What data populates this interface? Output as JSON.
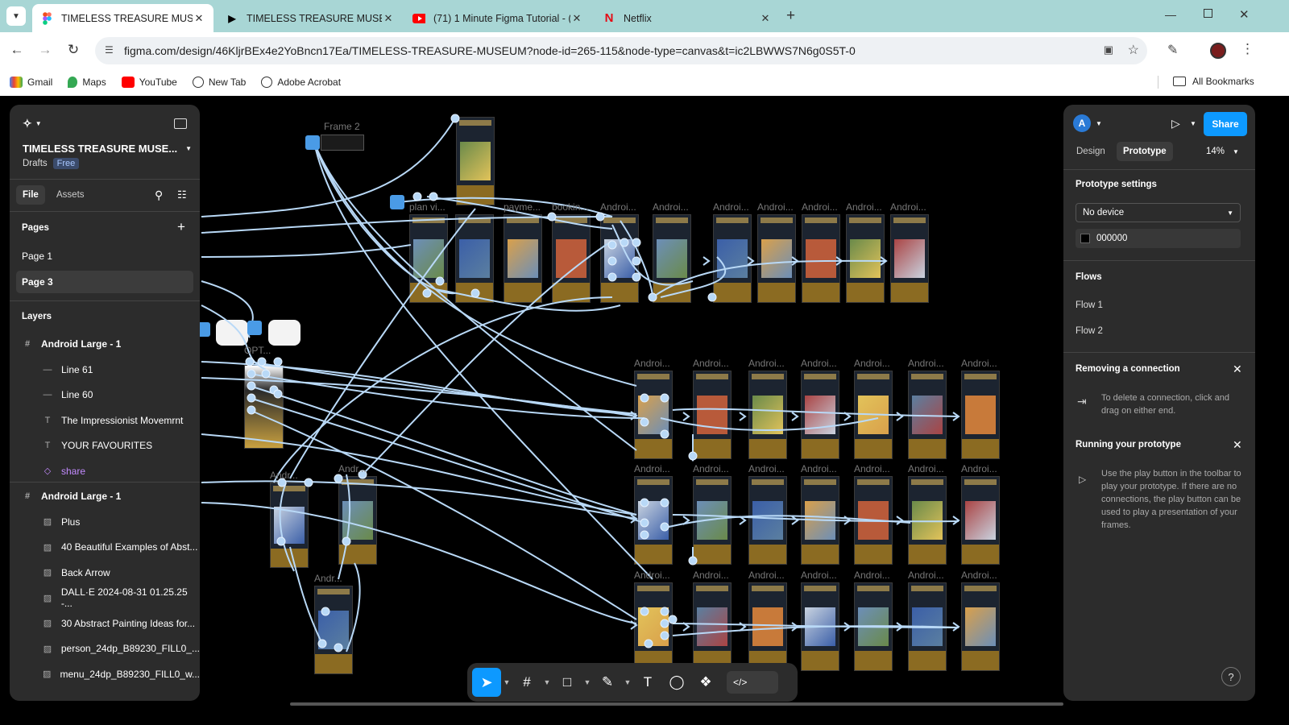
{
  "browser": {
    "tabs": [
      {
        "title": "TIMELESS TREASURE MUSEUM",
        "icon": "figma-icon",
        "active": true
      },
      {
        "title": "TIMELESS TREASURE MUSEUM",
        "icon": "play-icon"
      },
      {
        "title": "(71) 1 Minute Figma Tutorial - (",
        "icon": "youtube-icon"
      },
      {
        "title": "Netflix",
        "icon": "netflix-icon"
      }
    ],
    "url": "figma.com/design/46KljrBEx4e2YoBncn17Ea/TIMELESS-TREASURE-MUSEUM?node-id=265-115&node-type=canvas&t=ic2LBWWS7N6g0S5T-0",
    "bookmarks": [
      "Gmail",
      "Maps",
      "YouTube",
      "New Tab",
      "Adobe Acrobat"
    ],
    "all_bookmarks": "All Bookmarks"
  },
  "left_panel": {
    "file_title": "TIMELESS TREASURE MUSE...",
    "location": "Drafts",
    "plan_badge": "Free",
    "tabs": [
      "File",
      "Assets"
    ],
    "pages_heading": "Pages",
    "pages": [
      "Page 1",
      "Page 3"
    ],
    "layers_heading": "Layers",
    "layers": [
      {
        "name": "Android Large - 1",
        "type": "frame",
        "indent": 0
      },
      {
        "name": "Line 61",
        "type": "line",
        "indent": 1
      },
      {
        "name": "Line 60",
        "type": "line",
        "indent": 1
      },
      {
        "name": "The Impressionist Movemrnt",
        "type": "text",
        "indent": 1
      },
      {
        "name": "YOUR FAVOURITES",
        "type": "text",
        "indent": 1
      },
      {
        "name": "share",
        "type": "component",
        "indent": 1
      },
      {
        "name": "Android Large - 1",
        "type": "frame",
        "indent": 0
      },
      {
        "name": "Plus",
        "type": "image",
        "indent": 1
      },
      {
        "name": "40 Beautiful Examples of Abst...",
        "type": "image",
        "indent": 1
      },
      {
        "name": "Back Arrow",
        "type": "image",
        "indent": 1
      },
      {
        "name": "DALL·E 2024-08-31 01.25.25 -...",
        "type": "image",
        "indent": 1
      },
      {
        "name": "30 Abstract Painting Ideas for...",
        "type": "image",
        "indent": 1
      },
      {
        "name": "person_24dp_B89230_FILL0_...",
        "type": "image",
        "indent": 1
      },
      {
        "name": "menu_24dp_B89230_FILL0_w...",
        "type": "image",
        "indent": 1
      }
    ]
  },
  "right_panel": {
    "avatar": "A",
    "share_label": "Share",
    "tabs": [
      "Design",
      "Prototype"
    ],
    "zoom": "14%",
    "settings_heading": "Prototype settings",
    "device": "No device",
    "bg_color": "000000",
    "flows_heading": "Flows",
    "flows": [
      "Flow 1",
      "Flow 2"
    ],
    "tip1_title": "Removing a connection",
    "tip1_body": "To delete a connection, click and drag on either end.",
    "tip2_title": "Running your prototype",
    "tip2_body": "Use the play button in the toolbar to play your prototype. If there are no connections, the play button can be used to play a presentation of your frames.",
    "help": "?"
  },
  "canvas_labels": {
    "frame2": "Frame 2",
    "android": "Androi...",
    "android_short": "Andr...",
    "an": "An...",
    "payment": "payme...",
    "booking": "bookin...",
    "plan": "plan vi...",
    "opt": "OPT..."
  },
  "toolbar": [
    "move-tool",
    "frame-tool",
    "shape-tool",
    "pen-tool",
    "text-tool",
    "comment-tool",
    "assets-tool",
    "dev-mode-toggle"
  ]
}
